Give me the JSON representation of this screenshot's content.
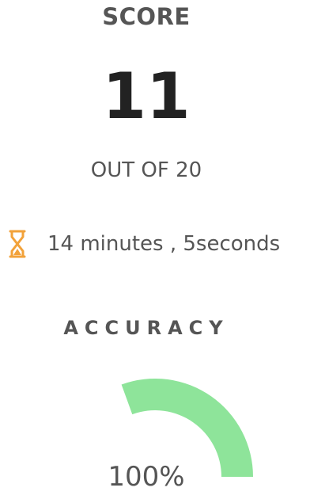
{
  "score": {
    "title": "SCORE",
    "value": "11",
    "total_label": "OUT OF 20"
  },
  "time": {
    "icon": "hourglass-icon",
    "text": "14 minutes , 5seconds"
  },
  "accuracy": {
    "title": "ACCURACY",
    "value_label": "100%",
    "fraction": 1.0
  },
  "colors": {
    "gauge_fill": "#8ee49a",
    "hourglass": "#f2a23a",
    "text": "#555555",
    "score_value": "#222222"
  }
}
